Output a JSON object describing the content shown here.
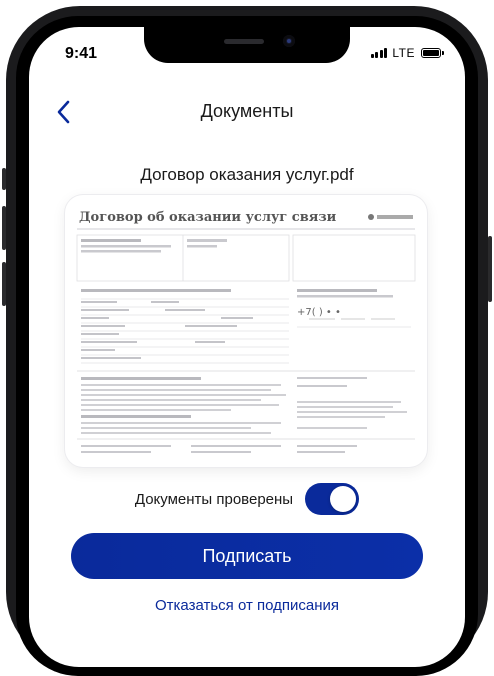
{
  "status_bar": {
    "time": "9:41",
    "network": "LTE"
  },
  "nav": {
    "back_icon": "chevron-left-icon",
    "title": "Документы"
  },
  "document": {
    "file_name": "Договор оказания услуг.pdf",
    "preview_title": "Договор об оказании услуг связи",
    "preview_phone": "+7(   )      •      •"
  },
  "verification": {
    "label": "Документы проверены",
    "checked": true
  },
  "actions": {
    "sign_label": "Подписать",
    "decline_label": "Отказаться от подписания"
  },
  "colors": {
    "accent": "#0a2a9b",
    "text": "#1a1a1a",
    "background": "#ffffff"
  }
}
